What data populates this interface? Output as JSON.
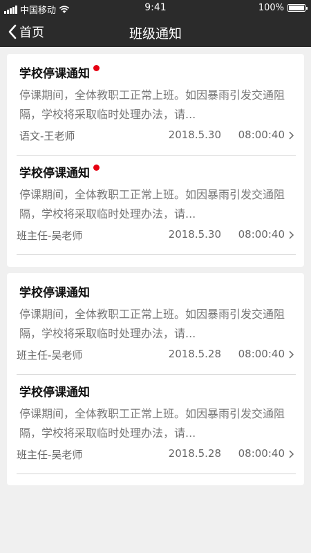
{
  "status_bar": {
    "carrier": "中国移动",
    "time": "9:41",
    "battery": "100%",
    "battery_level": 1.0
  },
  "nav": {
    "back_label": "首页",
    "title": "班级通知"
  },
  "colors": {
    "bar_bg": "#2b2b2b",
    "page_bg": "#f0f0f0",
    "unread_dot": "#e60012"
  },
  "notices": [
    {
      "title": "学校停课通知",
      "unread": true,
      "body": "停课期间，全体教职工正常上班。如因暴雨引发交通阻隔，学校将采取临时处理办法，请...",
      "author": "语文-王老师",
      "date": "2018.5.30",
      "time": "08:00:40"
    },
    {
      "title": "学校停课通知",
      "unread": true,
      "body": "停课期间，全体教职工正常上班。如因暴雨引发交通阻隔，学校将采取临时处理办法，请...",
      "author": "班主任-吴老师",
      "date": "2018.5.30",
      "time": "08:00:40"
    },
    {
      "title": "学校停课通知",
      "unread": false,
      "body": "停课期间，全体教职工正常上班。如因暴雨引发交通阻隔，学校将采取临时处理办法，请...",
      "author": "班主任-吴老师",
      "date": "2018.5.28",
      "time": "08:00:40"
    },
    {
      "title": "学校停课通知",
      "unread": false,
      "body": "停课期间，全体教职工正常上班。如因暴雨引发交通阻隔，学校将采取临时处理办法，请...",
      "author": "班主任-吴老师",
      "date": "2018.5.28",
      "time": "08:00:40"
    }
  ]
}
